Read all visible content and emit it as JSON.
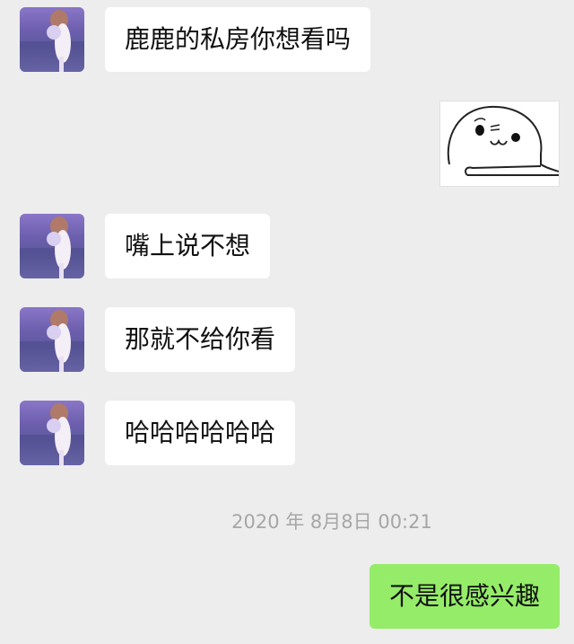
{
  "messages": [
    {
      "sender": "contact",
      "text": "鹿鹿的私房你想看吗"
    },
    {
      "sender": "contact",
      "type": "sticker",
      "sticker": "round-face-blushing-sticker"
    },
    {
      "sender": "contact",
      "text": "嘴上说不想"
    },
    {
      "sender": "contact",
      "text": "那就不给你看"
    },
    {
      "sender": "contact",
      "text": "哈哈哈哈哈哈"
    },
    {
      "sender": "self",
      "text": "不是很感兴趣"
    }
  ],
  "timestamp": "2020 年 8月8日 00:21",
  "colors": {
    "background": "#ededed",
    "received_bubble": "#ffffff",
    "sent_bubble": "#95ec69"
  }
}
